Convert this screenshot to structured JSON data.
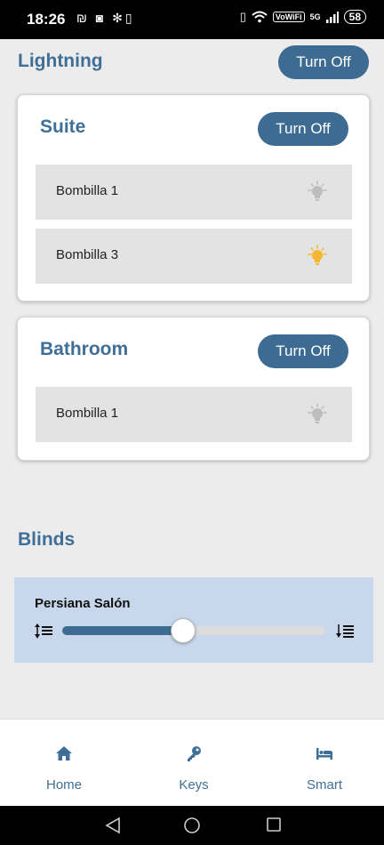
{
  "status_bar": {
    "time": "18:26",
    "left_icons": "₪ ◙ ✻▯",
    "vowifi": "VoWiFi",
    "signal": "5G",
    "battery": "58"
  },
  "lighting": {
    "title": "Lightning",
    "turn_off_label": "Turn Off",
    "rooms": [
      {
        "name": "Suite",
        "turn_off_label": "Turn Off",
        "bulbs": [
          {
            "label": "Bombilla 1",
            "state": "off"
          },
          {
            "label": "Bombilla 3",
            "state": "on"
          }
        ]
      },
      {
        "name": "Bathroom",
        "turn_off_label": "Turn Off",
        "bulbs": [
          {
            "label": "Bombilla 1",
            "state": "off"
          }
        ]
      }
    ]
  },
  "blinds": {
    "title": "Blinds",
    "items": [
      {
        "name": "Persiana Salón",
        "level_fraction": 0.46
      }
    ]
  },
  "bottom_nav": {
    "items": [
      {
        "label": "Home",
        "icon": "home-icon"
      },
      {
        "label": "Keys",
        "icon": "key-icon"
      },
      {
        "label": "Smart",
        "icon": "bed-icon"
      }
    ]
  },
  "colors": {
    "accent": "#3e6b92",
    "bulb_on": "#f5b731",
    "bulb_off": "#bdbdbd"
  }
}
